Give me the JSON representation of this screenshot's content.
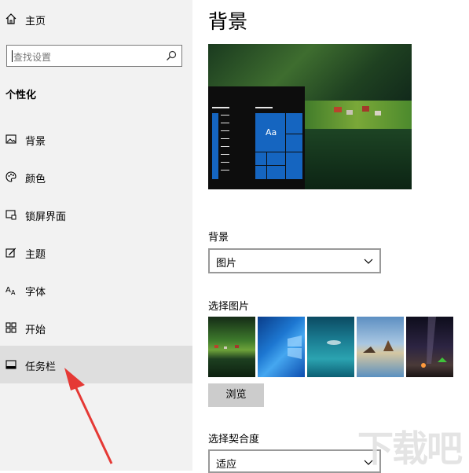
{
  "sidebar": {
    "home_label": "主页",
    "search_placeholder": "查找设置",
    "section_title": "个性化",
    "items": [
      {
        "label": "背景",
        "icon": "picture-icon"
      },
      {
        "label": "颜色",
        "icon": "palette-icon"
      },
      {
        "label": "锁屏界面",
        "icon": "lock-screen-icon"
      },
      {
        "label": "主题",
        "icon": "theme-brush-icon"
      },
      {
        "label": "字体",
        "icon": "font-icon"
      },
      {
        "label": "开始",
        "icon": "start-grid-icon"
      },
      {
        "label": "任务栏",
        "icon": "taskbar-icon",
        "active": true
      }
    ]
  },
  "main": {
    "title": "背景",
    "preview_tile_text": "Aa",
    "background_label": "背景",
    "background_value": "图片",
    "choose_picture_label": "选择图片",
    "browse_label": "浏览",
    "fit_label": "选择契合度",
    "fit_value": "适应"
  },
  "watermark": {
    "text": "下载吧"
  },
  "colors": {
    "sidebar_bg": "#f2f2f2",
    "active_item_bg": "#dedede",
    "tile_blue": "#1565c0",
    "arrow_red": "#e53935",
    "button_gray": "#cccccc"
  }
}
